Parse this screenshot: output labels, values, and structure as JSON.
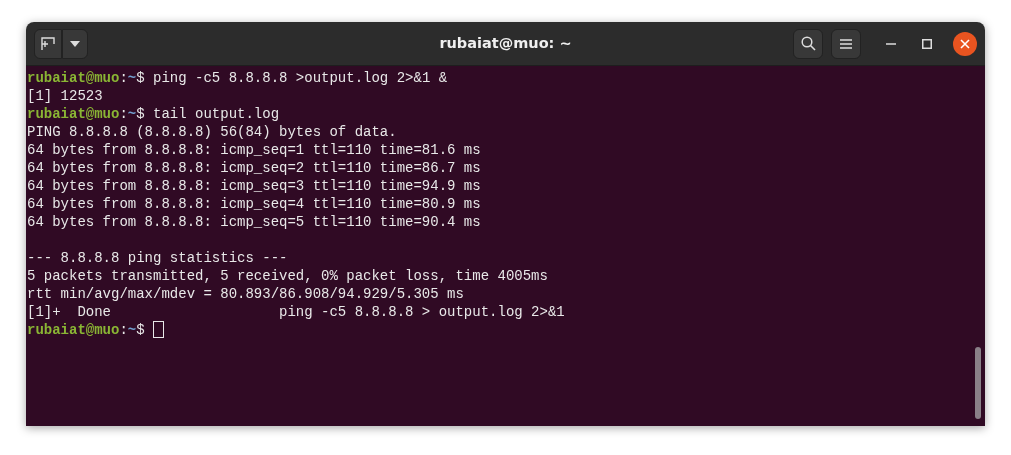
{
  "window": {
    "title": "rubaiat@muo: ~"
  },
  "terminal": {
    "lines": [
      {
        "kind": "prompt",
        "user": "rubaiat@muo",
        "separator": ":",
        "path": "~",
        "symbol": "$",
        "command": " ping -c5 8.8.8.8 >output.log 2>&1 &"
      },
      {
        "kind": "output",
        "text": "[1] 12523"
      },
      {
        "kind": "prompt",
        "user": "rubaiat@muo",
        "separator": ":",
        "path": "~",
        "symbol": "$",
        "command": " tail output.log"
      },
      {
        "kind": "output",
        "text": "PING 8.8.8.8 (8.8.8.8) 56(84) bytes of data."
      },
      {
        "kind": "output",
        "text": "64 bytes from 8.8.8.8: icmp_seq=1 ttl=110 time=81.6 ms"
      },
      {
        "kind": "output",
        "text": "64 bytes from 8.8.8.8: icmp_seq=2 ttl=110 time=86.7 ms"
      },
      {
        "kind": "output",
        "text": "64 bytes from 8.8.8.8: icmp_seq=3 ttl=110 time=94.9 ms"
      },
      {
        "kind": "output",
        "text": "64 bytes from 8.8.8.8: icmp_seq=4 ttl=110 time=80.9 ms"
      },
      {
        "kind": "output",
        "text": "64 bytes from 8.8.8.8: icmp_seq=5 ttl=110 time=90.4 ms"
      },
      {
        "kind": "blank"
      },
      {
        "kind": "output",
        "text": "--- 8.8.8.8 ping statistics ---"
      },
      {
        "kind": "output",
        "text": "5 packets transmitted, 5 received, 0% packet loss, time 4005ms"
      },
      {
        "kind": "output",
        "text": "rtt min/avg/max/mdev = 80.893/86.908/94.929/5.305 ms"
      },
      {
        "kind": "output",
        "text": "[1]+  Done                    ping -c5 8.8.8.8 > output.log 2>&1"
      },
      {
        "kind": "prompt",
        "user": "rubaiat@muo",
        "separator": ":",
        "path": "~",
        "symbol": "$",
        "cursor": true
      }
    ]
  }
}
